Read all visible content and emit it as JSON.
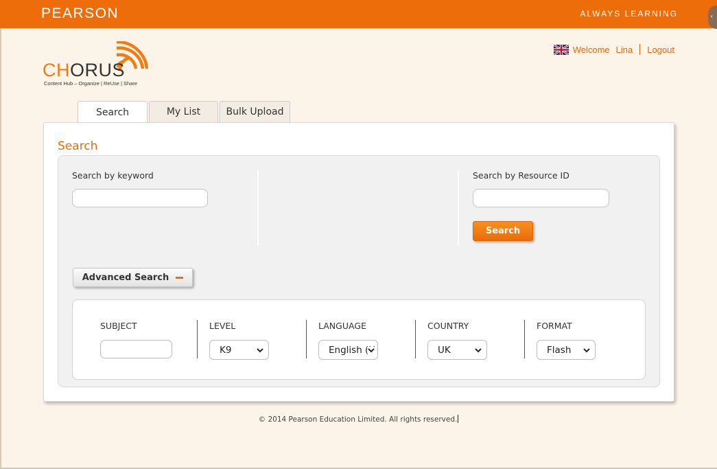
{
  "header": {
    "brand": "PEARSON",
    "tagline": "ALWAYS LEARNING"
  },
  "logo": {
    "part1": "CH",
    "part2": "ORUS",
    "subtitle": "Content Hub – Organize | ReUse | Share"
  },
  "user": {
    "welcome": "Welcome",
    "name": "Lina",
    "logout": "Logout",
    "flag_icon": "uk-flag-icon"
  },
  "tabs": [
    {
      "label": "Search"
    },
    {
      "label": "My List"
    },
    {
      "label": "Bulk Upload"
    }
  ],
  "search": {
    "title": "Search",
    "keyword_label": "Search by keyword",
    "keyword_value": "",
    "resource_label": "Search by Resource ID",
    "resource_value": "",
    "button": "Search",
    "advanced_button": "Advanced Search"
  },
  "advanced": {
    "subject": {
      "label": "SUBJECT",
      "value": ""
    },
    "level": {
      "label": "LEVEL",
      "value": "K9"
    },
    "language": {
      "label": "LANGUAGE",
      "value": "English (U"
    },
    "country": {
      "label": "COUNTRY",
      "value": "UK"
    },
    "format": {
      "label": "FORMAT",
      "value": "Flash"
    }
  },
  "footer": {
    "text": "© 2014 Pearson Education Limited. All rights reserved."
  },
  "colors": {
    "accent": "#ed6d0a",
    "background": "#fcf4e9"
  }
}
